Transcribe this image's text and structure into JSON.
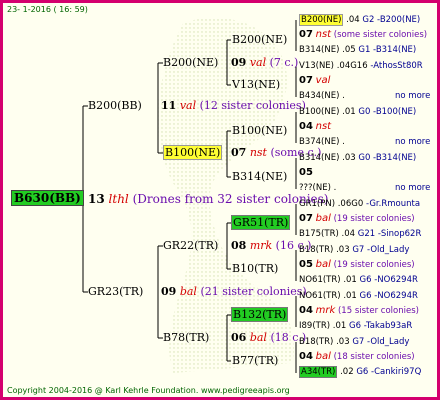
{
  "header": "23- 1-2016 ( 16: 59)",
  "footer": "Copyright 2004-2016 @ Karl Kehrle Foundation.   www.pedigreeapis.org",
  "root": {
    "label": "B630(BB)",
    "gen": "13",
    "mark": "lthl",
    "note": "(Drones from 32 sister colonies)"
  },
  "l1": [
    {
      "label": "B200(BB)",
      "gen": "11",
      "mark": "val",
      "note": "(12 sister colonies)"
    },
    {
      "label": "GR23(TR)",
      "gen": "09",
      "mark": "bal",
      "note": "(21 sister colonies)"
    }
  ],
  "l2": [
    {
      "label": "B200(NE)",
      "gen": "09",
      "mark": "val",
      "note": "(7 c.)"
    },
    {
      "label": "B100(NE)",
      "gen": "07",
      "mark": "nst",
      "note": "(some c.)"
    },
    {
      "label": "GR22(TR)",
      "gen": "08",
      "mark": "mrk",
      "note": "(16 c.)"
    },
    {
      "label": "B78(TR)",
      "gen": "06",
      "mark": "bal",
      "note": "(18 c.)"
    }
  ],
  "l3": [
    "B200(NE)",
    "V13(NE)",
    "B100(NE)",
    "B314(NE)",
    "GR51(TR)",
    "B10(TR)",
    "B132(TR)",
    "B77(TR)"
  ],
  "l4": [
    {
      "a": "B200(NE)",
      "b": ".04",
      "c": "G2 -B200(NE)"
    },
    {
      "gen": "07",
      "mark": "nst",
      "note": "(some sister colonies)"
    },
    {
      "a": "B314(NE)",
      "b": ".05",
      "c": "G1 -B314(NE)"
    },
    {
      "a": "V13(NE)",
      "b": ".04G16",
      "c": "-AthosSt80R"
    },
    {
      "gen": "07",
      "mark": "val",
      "note": ""
    },
    {
      "a": "B434(NE)",
      "b": ".",
      "c": "no more"
    },
    {
      "a": "B100(NE)",
      "b": ".01",
      "c": "G0 -B100(NE)"
    },
    {
      "gen": "04",
      "mark": "nst",
      "note": ""
    },
    {
      "a": "B374(NE)",
      "b": ".",
      "c": "no more"
    },
    {
      "a": "B314(NE)",
      "b": ".03",
      "c": "G0 -B314(NE)"
    },
    {
      "gen": "05",
      "mark": "",
      "note": ""
    },
    {
      "a": "???(NE)",
      "b": ".",
      "c": "no more"
    },
    {
      "a": "GR1(PN)",
      "b": ".06G0",
      "c": "-Gr.Rmounta"
    },
    {
      "gen": "07",
      "mark": "bal",
      "note": "(19 sister colonies)"
    },
    {
      "a": "B175(TR)",
      "b": ".04",
      "c": "G21 -Sinop62R"
    },
    {
      "a": "B18(TR)",
      "b": ".03",
      "c": "G7 -Old_Lady"
    },
    {
      "gen": "05",
      "mark": "bal",
      "note": "(19 sister colonies)"
    },
    {
      "a": "NO61(TR)",
      "b": ".01",
      "c": "G6 -NO6294R"
    },
    {
      "a": "NO61(TR)",
      "b": ".01",
      "c": "G6 -NO6294R"
    },
    {
      "gen": "04",
      "mark": "mrk",
      "note": "(15 sister colonies)"
    },
    {
      "a": "I89(TR)",
      "b": ".01",
      "c": "G6 -Takab93aR"
    },
    {
      "a": "B18(TR)",
      "b": ".03",
      "c": "G7 -Old_Lady"
    },
    {
      "gen": "04",
      "mark": "bal",
      "note": "(18 sister colonies)"
    },
    {
      "a": "A34(TR)",
      "b": ".02",
      "c": "G6 -Cankiri97Q"
    }
  ]
}
